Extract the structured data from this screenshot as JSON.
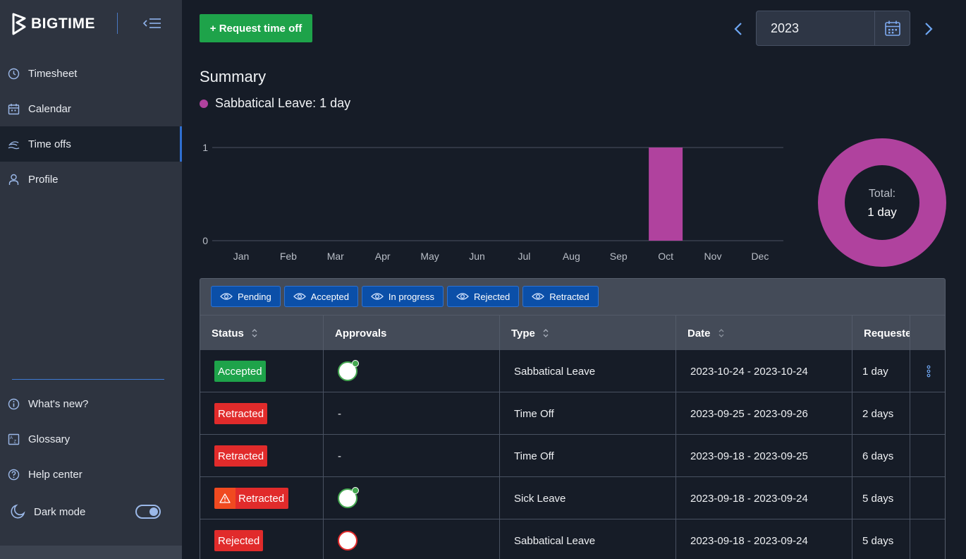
{
  "app": {
    "name": "BIGTIME"
  },
  "sidebar": {
    "nav": [
      {
        "label": "Timesheet",
        "icon": "clock-icon"
      },
      {
        "label": "Calendar",
        "icon": "calendar-icon"
      },
      {
        "label": "Time offs",
        "icon": "beach-icon",
        "active": true
      },
      {
        "label": "Profile",
        "icon": "user-icon"
      }
    ],
    "footer": [
      {
        "label": "What's new?",
        "icon": "info-icon"
      },
      {
        "label": "Glossary",
        "icon": "glossary-icon"
      },
      {
        "label": "Help center",
        "icon": "help-icon"
      }
    ],
    "dark_mode": {
      "label": "Dark mode",
      "on": true
    }
  },
  "toolbar": {
    "request_label": "+ Request time off",
    "year": "2023"
  },
  "summary": {
    "title": "Summary",
    "legend_label": "Sabbatical Leave: 1 day",
    "donut_label": "Total:",
    "donut_value": "1 day"
  },
  "chart_data": {
    "type": "bar",
    "categories": [
      "Jan",
      "Feb",
      "Mar",
      "Apr",
      "May",
      "Jun",
      "Jul",
      "Aug",
      "Sep",
      "Oct",
      "Nov",
      "Dec"
    ],
    "series": [
      {
        "name": "Sabbatical Leave",
        "values": [
          0,
          0,
          0,
          0,
          0,
          0,
          0,
          0,
          0,
          1,
          0,
          0
        ],
        "color": "#b0429e"
      }
    ],
    "yticks": [
      "0",
      "1"
    ],
    "ylim": [
      0,
      1
    ]
  },
  "filters": [
    "Pending",
    "Accepted",
    "In progress",
    "Rejected",
    "Retracted"
  ],
  "table": {
    "headers": {
      "status": "Status",
      "approvals": "Approvals",
      "type": "Type",
      "date": "Date",
      "requested": "Requeste"
    },
    "rows": [
      {
        "status": "Accepted",
        "status_kind": "accepted",
        "approval": "approved",
        "type": "Sabbatical Leave",
        "date": "2023-10-24 - 2023-10-24",
        "requested": "1 day",
        "menu": true
      },
      {
        "status": "Retracted",
        "status_kind": "retracted",
        "approval": "-",
        "type": "Time Off",
        "date": "2023-09-25 - 2023-09-26",
        "requested": "2 days"
      },
      {
        "status": "Retracted",
        "status_kind": "retracted",
        "approval": "-",
        "type": "Time Off",
        "date": "2023-09-18 - 2023-09-25",
        "requested": "6 days"
      },
      {
        "status": "Retracted",
        "status_kind": "warning",
        "approval": "approved",
        "type": "Sick Leave",
        "date": "2023-09-18 - 2023-09-24",
        "requested": "5 days"
      },
      {
        "status": "Rejected",
        "status_kind": "rejected",
        "approval": "rejected",
        "type": "Sabbatical Leave",
        "date": "2023-09-18 - 2023-09-24",
        "requested": "5 days"
      }
    ]
  }
}
